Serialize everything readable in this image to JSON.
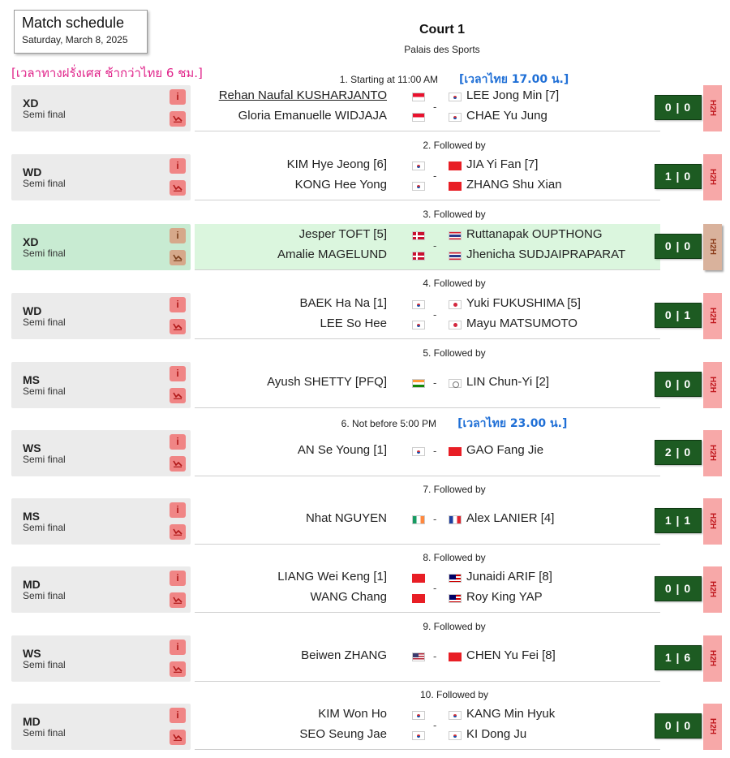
{
  "header": {
    "title": "Match schedule",
    "date": "Saturday, March 8, 2025",
    "court": "Court 1",
    "venue": "Palais des Sports",
    "timezone_note": "[เวลาทางฝรั่งเศส ช้ากว่าไทย 6 ชม.]"
  },
  "matches": [
    {
      "order": "1. Starting at 11:00 AM",
      "thai_time": "[เวลาไทย 17.00 น.]",
      "event": "XD",
      "round": "Semi final",
      "left": [
        "Rehan Naufal KUSHARJANTO",
        "Gloria Emanuelle WIDJAJA"
      ],
      "left_flag": "f-id",
      "right": [
        "LEE Jong Min [7]",
        "CHAE Yu Jung"
      ],
      "right_flag": "f-kr",
      "score": "0 | 0"
    },
    {
      "order": "2. Followed by",
      "event": "WD",
      "round": "Semi final",
      "left": [
        "KIM Hye Jeong [6]",
        "KONG Hee Yong"
      ],
      "left_flag": "f-kr",
      "right": [
        "JIA Yi Fan [7]",
        "ZHANG Shu Xian"
      ],
      "right_flag": "f-cn",
      "score": "1 | 0"
    },
    {
      "order": "3. Followed by",
      "event": "XD",
      "round": "Semi final",
      "left": [
        "Jesper TOFT [5]",
        "Amalie MAGELUND"
      ],
      "left_flag": "f-dk",
      "right": [
        "Ruttanapak OUPTHONG",
        "Jhenicha SUDJAIPRAPARAT"
      ],
      "right_flag": "f-th",
      "score": "0 | 0",
      "highlight": true
    },
    {
      "order": "4. Followed by",
      "event": "WD",
      "round": "Semi final",
      "left": [
        "BAEK Ha Na [1]",
        "LEE So Hee"
      ],
      "left_flag": "f-kr",
      "right": [
        "Yuki FUKUSHIMA [5]",
        "Mayu MATSUMOTO"
      ],
      "right_flag": "f-jp",
      "score": "0 | 1"
    },
    {
      "order": "5. Followed by",
      "event": "MS",
      "round": "Semi final",
      "left": [
        "Ayush SHETTY [PFQ]"
      ],
      "left_flag": "f-in",
      "right": [
        "LIN Chun-Yi [2]"
      ],
      "right_flag": "f-tw",
      "score": "0 | 0"
    },
    {
      "order": "6. Not before 5:00 PM",
      "thai_time": "[เวลาไทย 23.00 น.]",
      "event": "WS",
      "round": "Semi final",
      "left": [
        "AN Se Young [1]"
      ],
      "left_flag": "f-kr",
      "right": [
        "GAO Fang Jie"
      ],
      "right_flag": "f-cn",
      "score": "2 | 0"
    },
    {
      "order": "7. Followed by",
      "event": "MS",
      "round": "Semi final",
      "left": [
        "Nhat NGUYEN"
      ],
      "left_flag": "f-ie",
      "right": [
        "Alex LANIER [4]"
      ],
      "right_flag": "f-fr",
      "score": "1 | 1"
    },
    {
      "order": "8. Followed by",
      "event": "MD",
      "round": "Semi final",
      "left": [
        "LIANG Wei Keng [1]",
        "WANG Chang"
      ],
      "left_flag": "f-cn",
      "right": [
        "Junaidi ARIF [8]",
        "Roy King YAP"
      ],
      "right_flag": "f-my",
      "score": "0 | 0"
    },
    {
      "order": "9. Followed by",
      "event": "WS",
      "round": "Semi final",
      "left": [
        "Beiwen ZHANG"
      ],
      "left_flag": "f-us",
      "right": [
        "CHEN Yu Fei [8]"
      ],
      "right_flag": "f-cn",
      "score": "1 | 6"
    },
    {
      "order": "10. Followed by",
      "event": "MD",
      "round": "Semi final",
      "left": [
        "KIM Won Ho",
        "SEO Seung Jae"
      ],
      "left_flag": "f-kr",
      "right": [
        "KANG Min Hyuk",
        "KI Dong Ju"
      ],
      "right_flag": "f-kr",
      "score": "0 | 0"
    }
  ],
  "labels": {
    "h2h": "H2H",
    "info_icon": "i",
    "dash": "-"
  },
  "icons": {
    "info": "info-icon",
    "graph": "chart-icon"
  },
  "colors": {
    "score_bg": "#1d5b22",
    "h2h_bg": "#f7a8a8",
    "highlight_bg": "#dbf6de",
    "thai_note": "#e0248a",
    "thai_time": "#1f6fd6"
  }
}
